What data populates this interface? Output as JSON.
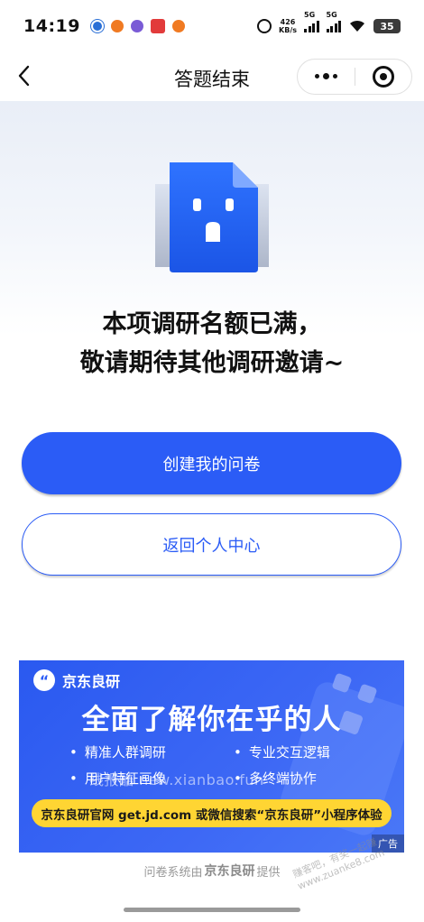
{
  "status_bar": {
    "time": "14:19",
    "net_speed_value": "426",
    "net_speed_unit": "KB/s",
    "signal1_label": "5G",
    "signal2_label": "5G",
    "battery": "35"
  },
  "nav": {
    "title": "答题结束"
  },
  "message": {
    "line1": "本项调研名额已满，",
    "line2": "敬请期待其他调研邀请~"
  },
  "buttons": {
    "create": "创建我的问卷",
    "back_home": "返回个人中心"
  },
  "ad": {
    "brand": "京东良研",
    "headline": "全面了解你在乎的人",
    "features": [
      "精准人群调研",
      "专业交互逻辑",
      "用户特征画像",
      "多终端协作"
    ],
    "watermark": "线报酷 new.xianbao.fun",
    "cta": "京东良研官网 get.jd.com 或微信搜索“京东良研”小程序体验",
    "tag": "广告"
  },
  "footer": {
    "prefix": "问卷系统由",
    "brand": "京东良研",
    "suffix": "提供",
    "site_watermark": "赚客吧，有奖一起赚 www.zuanke8.com"
  },
  "colors": {
    "primary": "#2b5cf6",
    "cta_yellow": "#ffd533"
  }
}
